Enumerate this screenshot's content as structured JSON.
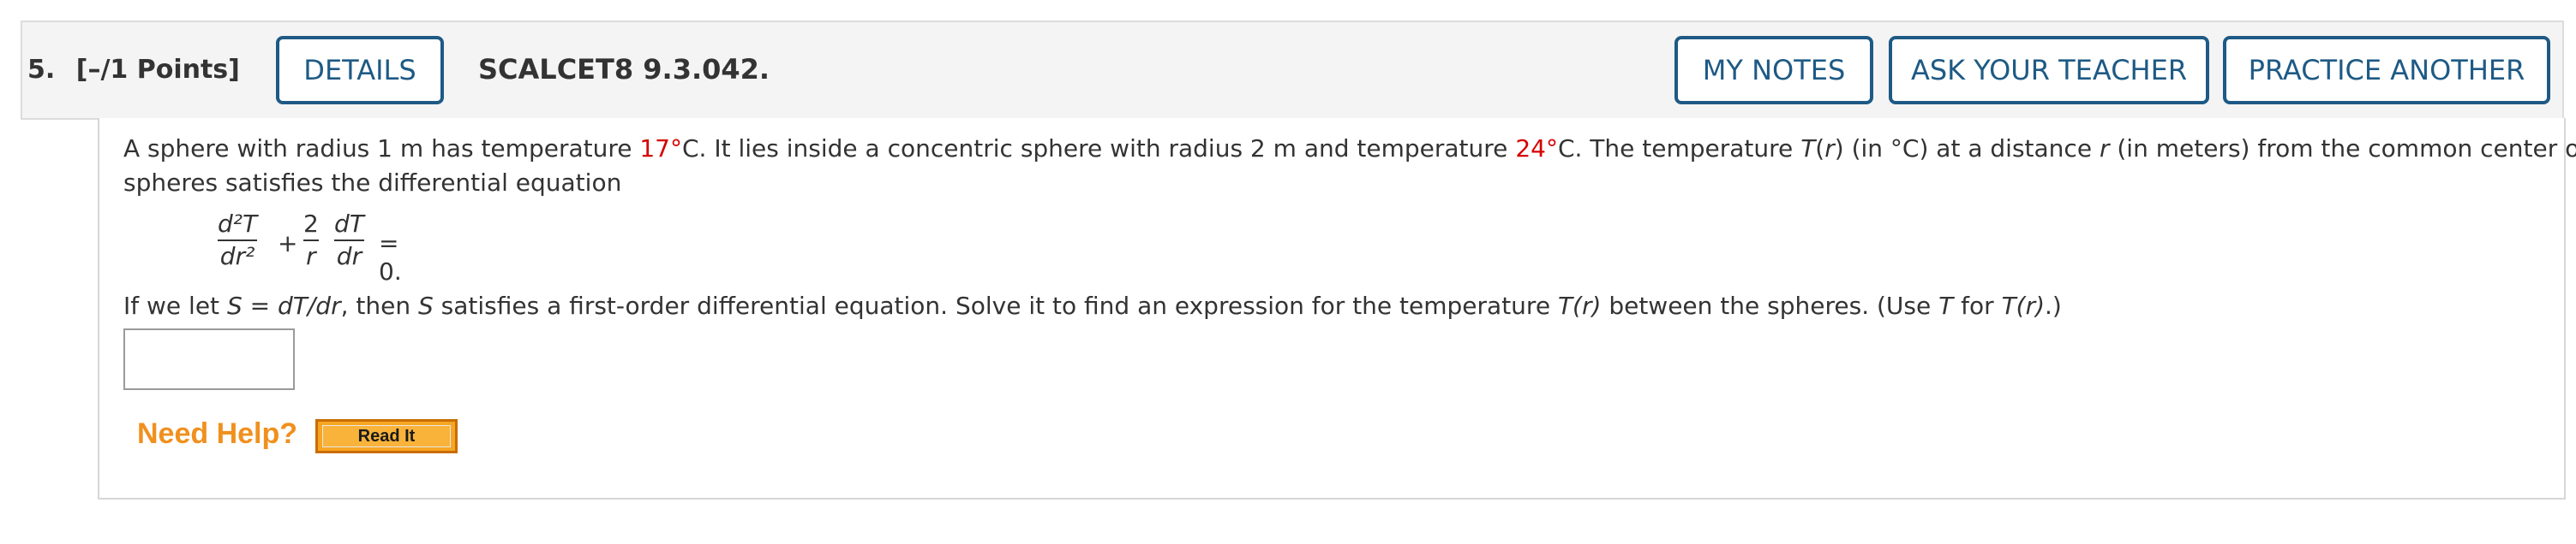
{
  "question": {
    "number": "5.",
    "points": "[–/1 Points]",
    "code": "SCALCET8 9.3.042."
  },
  "buttons": {
    "details": "DETAILS",
    "my_notes": "MY NOTES",
    "ask_teacher": "ASK YOUR TEACHER",
    "practice_another": "PRACTICE ANOTHER"
  },
  "problem": {
    "line1_a": "A sphere with radius 1 m has temperature ",
    "temp1": "17°",
    "line1_b": "C. It lies inside a concentric sphere with radius 2 m and temperature ",
    "temp2": "24°",
    "line1_c": "C. The temperature ",
    "T": "T",
    "line1_d": "(",
    "r": "r",
    "line1_e": ") (in °C) at a distance ",
    "line1_f": " (in meters) from the common center of the",
    "line2": "spheres satisfies the differential equation",
    "line3_a": "If we let ",
    "S": "S",
    "line3_b": " = ",
    "dTdr": "dT/dr",
    "line3_c": ", then ",
    "line3_d": " satisfies a first-order differential equation. Solve it to find an expression for the temperature ",
    "line3_e": " between the spheres. (Use ",
    "line3_f": " for ",
    "Tr": "T(r)",
    "line3_g": ".)"
  },
  "equation": {
    "frac1_num": "d²T",
    "frac1_den": "dr²",
    "plus": "+",
    "frac2_num": "2",
    "frac2_den": "r",
    "frac3_num": "dT",
    "frac3_den": "dr",
    "equals": "= 0."
  },
  "answer": {
    "value": ""
  },
  "help": {
    "need_help": "Need Help?",
    "read_it": "Read It"
  },
  "colors": {
    "button_border": "#1e5a85",
    "highlight_red": "#d60000",
    "need_help_orange": "#f0901e",
    "read_it_bg": "#f7a623"
  }
}
